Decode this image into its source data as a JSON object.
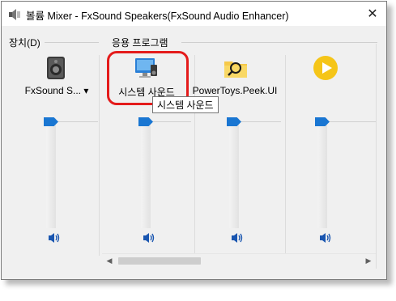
{
  "window": {
    "title": "볼륨 Mixer - FxSound Speakers(FxSound Audio Enhancer)",
    "close_glyph": "✕"
  },
  "device_group": {
    "label": "장치(D)"
  },
  "apps_group": {
    "label": "응용 프로그램"
  },
  "device": {
    "name": "FxSound S...",
    "dropdown_glyph": "▾",
    "icon": "speaker-device-icon",
    "volume_percent": 100
  },
  "apps": [
    {
      "name": "시스템 사운드",
      "icon": "system-sounds-icon",
      "volume_percent": 100
    },
    {
      "name": "PowerToys.Peek.UI",
      "icon": "folder-magnifier-icon",
      "volume_percent": 100
    },
    {
      "name": "",
      "icon": "play-circle-icon",
      "volume_percent": 100
    }
  ],
  "tooltip": {
    "text": "시스템 사운드"
  },
  "scrollbar": {
    "left_arrow": "◀",
    "right_arrow": "▶"
  },
  "colors": {
    "thumb": "#1976d2",
    "highlight": "#e41b1b",
    "play_yellow": "#f5c518"
  }
}
